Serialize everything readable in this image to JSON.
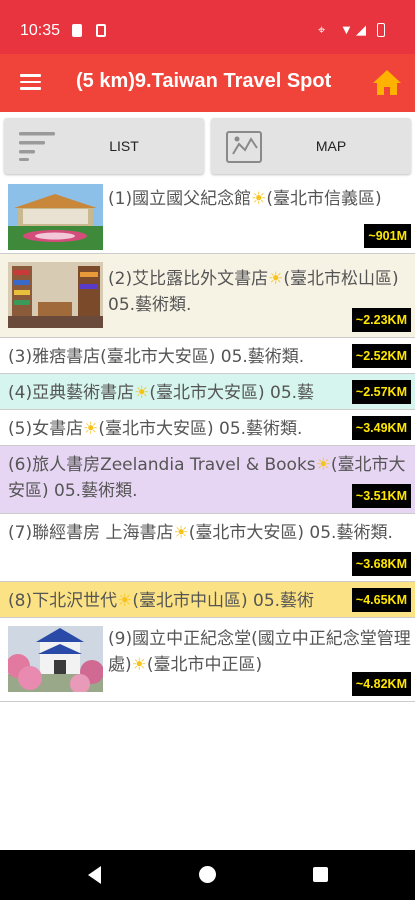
{
  "status": {
    "time": "10:35"
  },
  "appbar": {
    "title": "(5 km)9.Taiwan Travel Spot"
  },
  "tabs": {
    "list_label": "LIST",
    "map_label": "MAP"
  },
  "items": [
    {
      "text": "(1)國立國父紀念館",
      "region": "(臺北市信義區)",
      "distance": "~901M",
      "bg": "#ffffff",
      "has_image": true
    },
    {
      "text": "(2)艾比露比外文書店",
      "region": "(臺北市松山區) 05.藝術類.",
      "distance": "~2.23KM",
      "bg": "#f6f2e4",
      "has_image": true
    },
    {
      "text": "(3)雅痞書店(臺北市大安區) 05.藝術類.",
      "region": "",
      "distance": "~2.52KM",
      "bg": "#ffffff",
      "has_image": false
    },
    {
      "text": "(4)亞典藝術書店",
      "region": "(臺北市大安區) 05.藝",
      "distance": "~2.57KM",
      "bg": "#d6f5ee",
      "has_image": false
    },
    {
      "text": "(5)女書店",
      "region": "(臺北市大安區) 05.藝術類.",
      "distance": "~3.49KM",
      "bg": "#ffffff",
      "has_image": false
    },
    {
      "text": "(6)旅人書房Zeelandia Travel & Books",
      "region": "(臺北市大安區) 05.藝術類.",
      "distance": "~3.51KM",
      "bg": "#e7d6f3",
      "has_image": false
    },
    {
      "text": "(7)聯經書房 上海書店",
      "region": "(臺北市大安區) 05.藝術類.",
      "distance": "~3.68KM",
      "bg": "#ffffff",
      "has_image": false
    },
    {
      "text": "(8)下北沢世代",
      "region": "(臺北市中山區) 05.藝術",
      "distance": "~4.65KM",
      "bg": "#fbe285",
      "has_image": false
    },
    {
      "text": "(9)國立中正紀念堂(國立中正紀念堂管理處)",
      "region": "(臺北市中正區)",
      "distance": "~4.82KM",
      "bg": "#ffffff",
      "has_image": true
    }
  ],
  "colors": {
    "statusbar": "#e8343f",
    "appbar": "#f0443a",
    "home": "#ffb300",
    "distance_text": "#ffe600"
  }
}
